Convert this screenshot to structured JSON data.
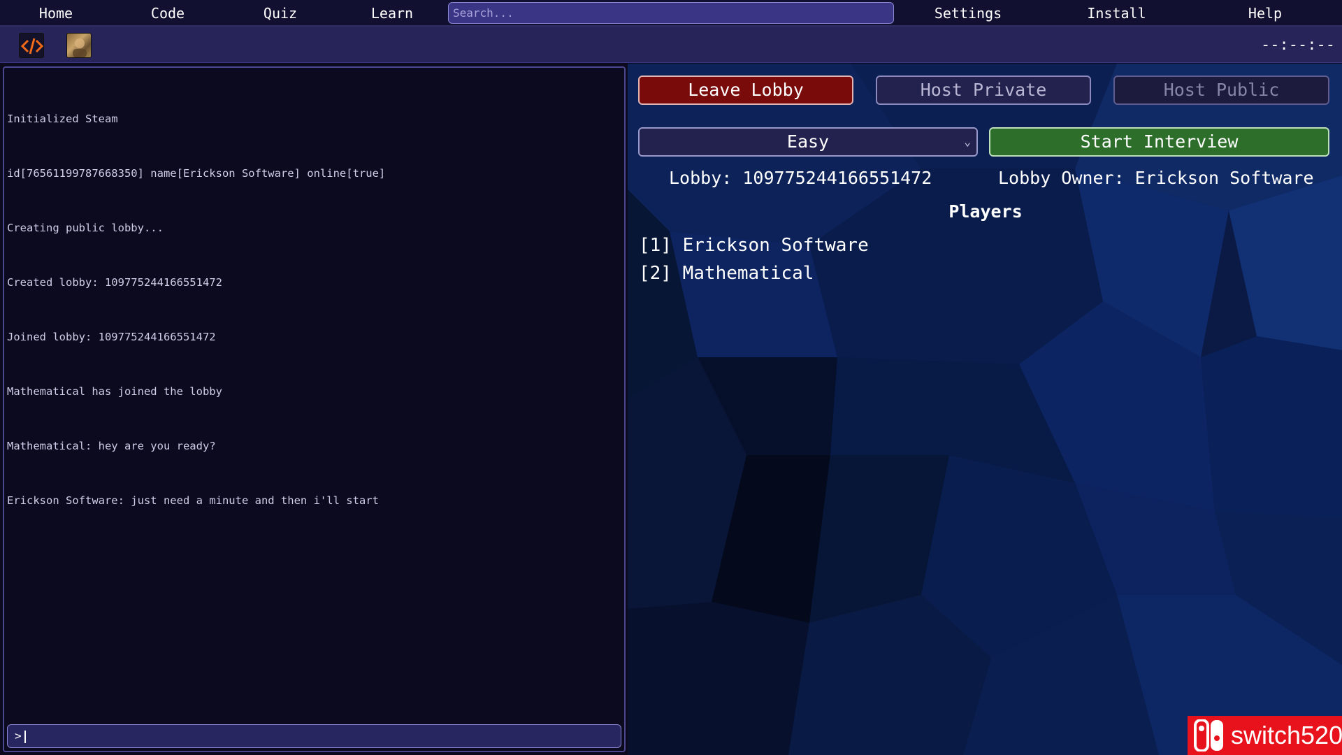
{
  "nav": {
    "home": "Home",
    "code": "Code",
    "quiz": "Quiz",
    "learn": "Learn",
    "search_placeholder": "Search...",
    "settings": "Settings",
    "install": "Install",
    "help": "Help"
  },
  "toolbar": {
    "code_icon": "code-brackets-icon",
    "avatar_icon": "avatar-image",
    "clock": "--:--:--"
  },
  "console": {
    "lines": [
      "Initialized Steam",
      "id[76561199787668350] name[Erickson Software] online[true]",
      "Creating public lobby...",
      "Created lobby: 109775244166551472",
      "Joined lobby: 109775244166551472",
      "Mathematical has joined the lobby",
      "Mathematical: hey are you ready?",
      "Erickson Software: just need a minute and then i'll start"
    ],
    "prompt": ">"
  },
  "lobby": {
    "leave_label": "Leave Lobby",
    "host_private_label": "Host Private",
    "host_public_label": "Host Public",
    "difficulty_selected": "Easy",
    "start_label": "Start Interview",
    "lobby_text": "Lobby: 109775244166551472",
    "owner_text": "Lobby Owner: Erickson Software",
    "players_title": "Players",
    "players": [
      "[1] Erickson Software",
      "[2] Mathematical"
    ]
  },
  "watermark": {
    "text": "switch520"
  },
  "colors": {
    "leave": "#7a0b0b",
    "start": "#2c6e2a",
    "topbar": "#121030",
    "toolbar": "#27245a",
    "watermark": "#e8121c"
  }
}
